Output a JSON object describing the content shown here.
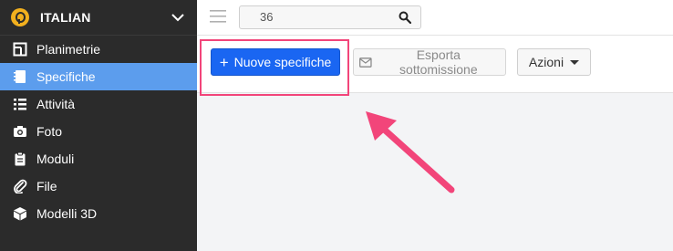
{
  "sidebar": {
    "project_name": "ITALIAN",
    "items": [
      {
        "label": "Planimetrie",
        "icon": "floorplan-icon",
        "active": false
      },
      {
        "label": "Specifiche",
        "icon": "notebook-icon",
        "active": true
      },
      {
        "label": "Attività",
        "icon": "list-icon",
        "active": false
      },
      {
        "label": "Foto",
        "icon": "camera-icon",
        "active": false
      },
      {
        "label": "Moduli",
        "icon": "clipboard-icon",
        "active": false
      },
      {
        "label": "File",
        "icon": "paperclip-icon",
        "active": false
      },
      {
        "label": "Modelli 3D",
        "icon": "cube-icon",
        "active": false
      }
    ]
  },
  "topbar": {
    "search_value": "36"
  },
  "toolbar": {
    "new_button": "Nuove specifiche",
    "export_button": "Esporta sottomissione",
    "actions_button": "Azioni"
  },
  "colors": {
    "sidebar_bg": "#2b2b2b",
    "active_item": "#5c9ded",
    "primary_button": "#1a66f2",
    "highlight": "#f2457a",
    "logo": "#f2b01e"
  }
}
